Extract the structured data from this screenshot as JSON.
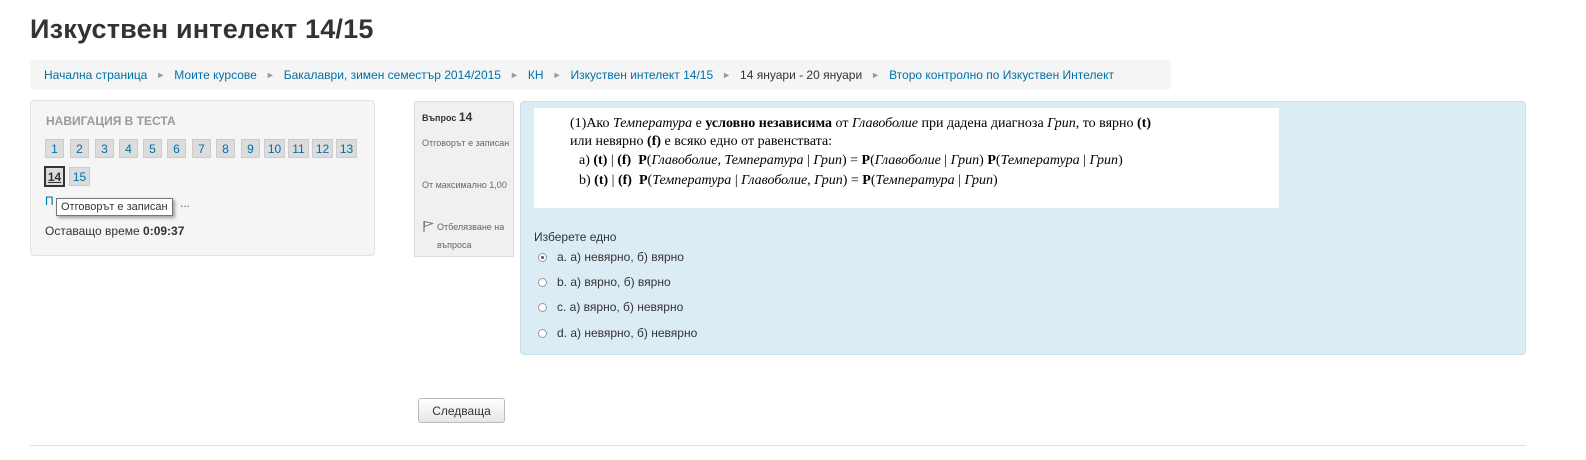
{
  "page_title": "Изкуствен интелект 14/15",
  "breadcrumb": [
    {
      "label": "Начална страница",
      "link": true
    },
    {
      "label": "Моите курсове",
      "link": true
    },
    {
      "label": "Бакалаври, зимен семестър 2014/2015",
      "link": true
    },
    {
      "label": "КН",
      "link": true
    },
    {
      "label": "Изкуствен интелект 14/15",
      "link": true
    },
    {
      "label": "14 януари - 20 януари",
      "link": false
    },
    {
      "label": "Второ контролно по Изкуствен Интелект",
      "link": true
    }
  ],
  "breadcrumb_separator": "►",
  "quiz_navigation": {
    "title": "НАВИГАЦИЯ В ТЕСТА",
    "row1": [
      "1",
      "2",
      "3",
      "4",
      "5",
      "6",
      "7",
      "8",
      "9",
      "10",
      "11",
      "12",
      "13"
    ],
    "row2": [
      "14",
      "15"
    ],
    "current": "14",
    "tooltip": "Отговорът е записан",
    "finish_link_visible_start": "П",
    "finish_link_visible_end": "...",
    "time_left_label": "Оставащо време",
    "time_left_value": "0:09:37"
  },
  "question_info": {
    "question_label": "Въпрос",
    "question_number": "14",
    "state": "Отговорът е записан",
    "grade": "От максимално 1,00",
    "flag_label": "Отбелязване на въпроса"
  },
  "question": {
    "text_lines": [
      "(1)Ако Температура е условно независима от Главоболие при дадена диагноза Грип, то вярно (t)",
      "или невярно (f) е всяко едно от равенствата:",
      "a) (t) | (f)  P(Главоболие, Температура | Грип) = P(Главоболие | Грип) P(Температура | Грип)",
      "b) (t) | (f)  P(Температура | Главоболие, Грип) = P(Температура | Грип)"
    ],
    "prompt": "Изберете едно",
    "options": [
      {
        "label": "a. а) невярно, б) вярно",
        "selected": true
      },
      {
        "label": "b. а) вярно, б) вярно",
        "selected": false
      },
      {
        "label": "c. а) вярно, б) невярно",
        "selected": false
      },
      {
        "label": "d. а) невярно, б) невярно",
        "selected": false
      }
    ]
  },
  "next_button_label": "Следваща",
  "colors": {
    "link": "#0070a8",
    "question_bg": "#dcecf5",
    "nav_bg": "#f5f5f5"
  }
}
